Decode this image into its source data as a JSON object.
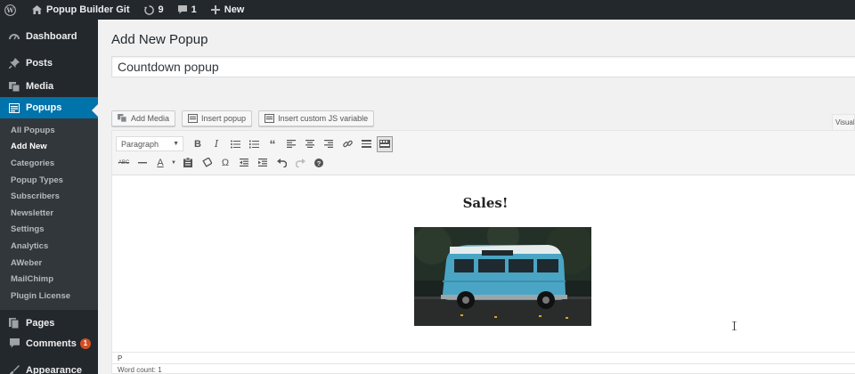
{
  "adminbar": {
    "site_name": "Popup Builder Git",
    "updates_count": "9",
    "comments_count": "1",
    "new_label": "New"
  },
  "sidebar": {
    "items": [
      {
        "label": "Dashboard",
        "icon": "dashboard-icon"
      },
      {
        "label": "Posts",
        "icon": "pin-icon"
      },
      {
        "label": "Media",
        "icon": "media-icon"
      },
      {
        "label": "Popups",
        "icon": "popup-icon"
      },
      {
        "label": "Pages",
        "icon": "pages-icon"
      },
      {
        "label": "Comments",
        "icon": "comment-icon",
        "badge": "1"
      },
      {
        "label": "Appearance",
        "icon": "brush-icon"
      }
    ],
    "submenu": [
      "All Popups",
      "Add New",
      "Categories",
      "Popup Types",
      "Subscribers",
      "Newsletter",
      "Settings",
      "Analytics",
      "AWeber",
      "MailChimp",
      "Plugin License"
    ]
  },
  "page": {
    "title": "Add New Popup",
    "post_title_value": "Countdown popup"
  },
  "media_buttons": {
    "add_media": "Add Media",
    "insert_popup": "Insert popup",
    "insert_js": "Insert custom JS variable"
  },
  "editor": {
    "visual_tab": "Visual",
    "format_select": "Paragraph",
    "heading": "Sales!",
    "path": "P",
    "word_count": "Word count: 1"
  },
  "colors": {
    "adminbar_bg": "#23282d",
    "active_menu": "#0073aa",
    "badge": "#d54e21",
    "van": "#4aa5c4"
  }
}
